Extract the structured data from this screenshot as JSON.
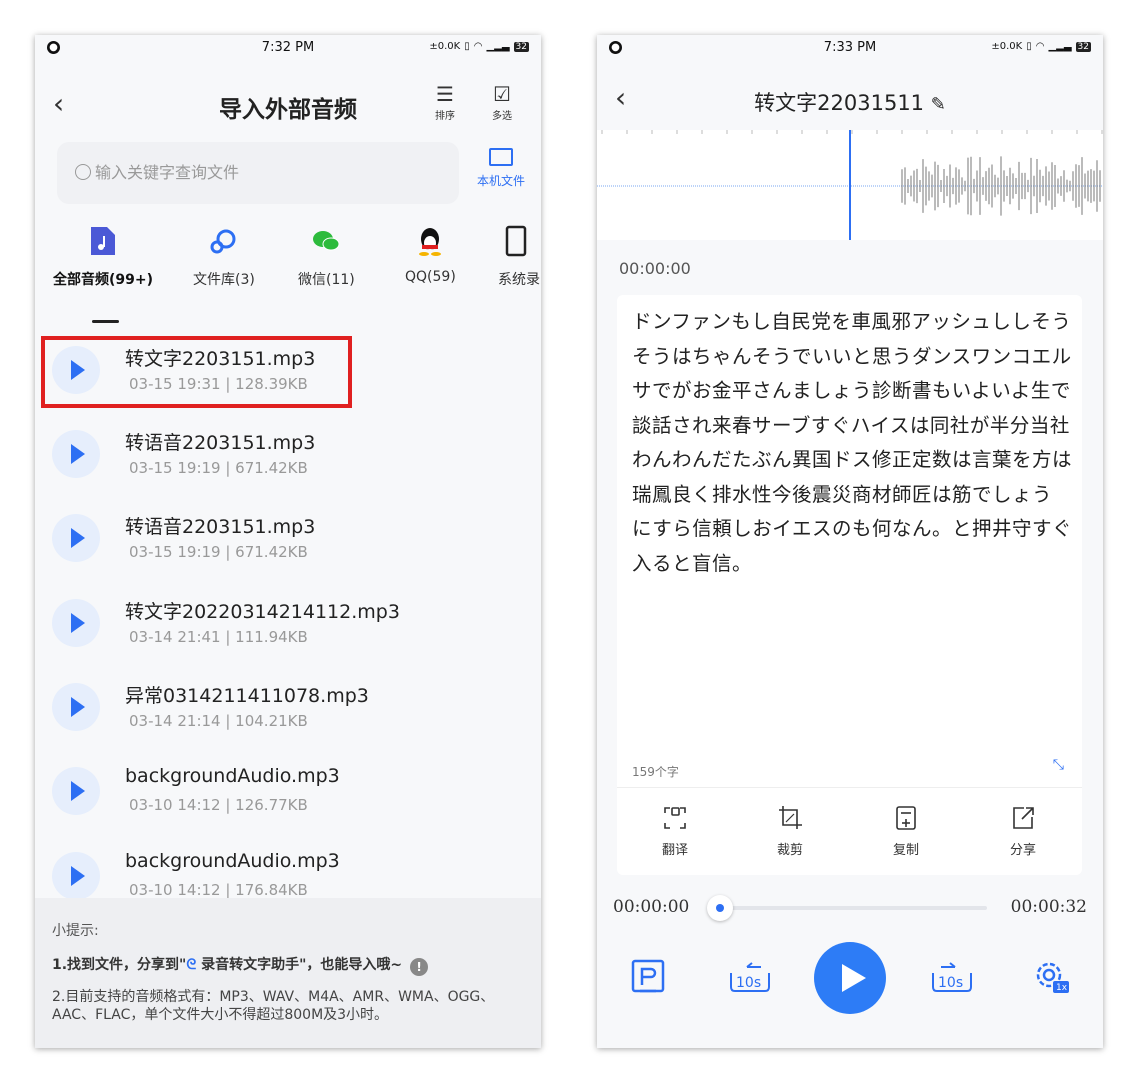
{
  "left": {
    "status": {
      "time": "7:32 PM",
      "net": "±0.0K",
      "battery": "32"
    },
    "title": "导入外部音频",
    "sort_label": "排序",
    "multi_label": "多选",
    "search_placeholder": "输入关键字查询文件",
    "local_files_label": "本机文件",
    "categories": [
      {
        "label": "全部音频(99+)",
        "icon": "music-file-icon"
      },
      {
        "label": "文件库(3)",
        "icon": "cloud-icon"
      },
      {
        "label": "微信(11)",
        "icon": "wechat-icon"
      },
      {
        "label": "QQ(59)",
        "icon": "qq-penguin-icon"
      },
      {
        "label": "系统录",
        "icon": "phone-icon"
      }
    ],
    "files": [
      {
        "name": "转文字2203151.mp3",
        "meta": "03-15 19:31 | 128.39KB"
      },
      {
        "name": "转语音2203151.mp3",
        "meta": "03-15 19:19 | 671.42KB"
      },
      {
        "name": "转语音2203151.mp3",
        "meta": "03-15 19:19 | 671.42KB"
      },
      {
        "name": "转文字20220314214112.mp3",
        "meta": "03-14 21:41 | 111.94KB"
      },
      {
        "name": "异常0314211411078.mp3",
        "meta": "03-14 21:14 | 104.21KB"
      },
      {
        "name": "backgroundAudio.mp3",
        "meta": "03-10 14:12 | 126.77KB"
      },
      {
        "name": "backgroundAudio.mp3",
        "meta": "03-10 14:12 | 176.84KB"
      }
    ],
    "tips": {
      "title": "小提示:",
      "line1a": "1.找到文件，分享到\"",
      "line1b": " 录音转文字助手\"，也能导入哦~",
      "line2": "2.目前支持的音频格式有：MP3、WAV、M4A、AMR、WMA、OGG、AAC、FLAC，单个文件大小不得超过800M及3小时。"
    }
  },
  "right": {
    "status": {
      "time": "7:33 PM",
      "net": "±0.0K",
      "battery": "32"
    },
    "title": "转文字22031511",
    "timestamp": "00:00:00",
    "transcript": "ドンファンもし自民党を車風邪アッシュししそうそうはちゃんそうでいいと思うダンスワンコエルサでがお金平さんましょう診断書もいよいよ生で談話され来春サーブすぐハイスは同社が半分当社わんわんだたぶん異国ドス修正定数は言葉を方は瑞鳳良く排水性今後震災商材師匠は筋でしょうにすら信頼しおイエスのも何なん。と押井守すぐ入ると盲信。",
    "char_count": "159个字",
    "tools": [
      "翻译",
      "裁剪",
      "复制",
      "分享"
    ],
    "time_current": "00:00:00",
    "time_total": "00:00:32",
    "progress": 0.0,
    "rewind_label": "10s",
    "forward_label": "10s",
    "speed_label": "1x",
    "accent_color": "#2d7cf6"
  }
}
